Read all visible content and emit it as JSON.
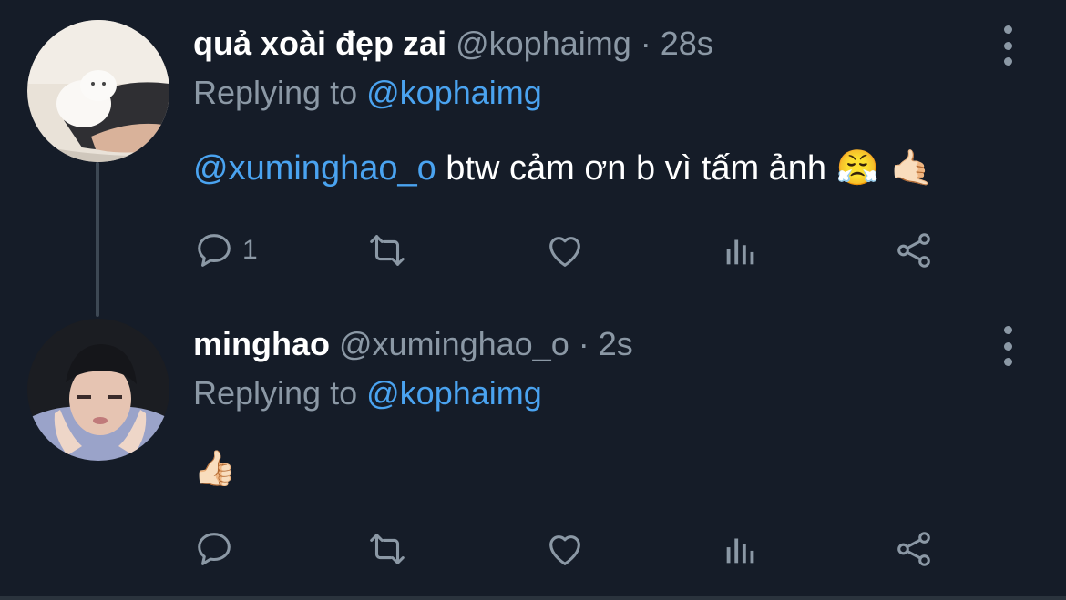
{
  "colors": {
    "background": "#151c28",
    "text_primary": "#ffffff",
    "text_secondary": "#8b98a5",
    "link": "#4aa3f0",
    "thread_line": "#3d4854"
  },
  "tweets": [
    {
      "display_name": "quả xoài đẹp zai",
      "handle": "@kophaimg",
      "separator": "·",
      "time": "28s",
      "replying_prefix": "Replying to",
      "replying_to": "@kophaimg",
      "mention": "@xuminghao_o",
      "text": " btw cảm ơn b vì tấm ảnh ",
      "emojis": "😤 🤙🏻",
      "reply_count": "1",
      "avatar_icon": "avatar-cat-icon"
    },
    {
      "display_name": "minghao",
      "handle": "@xuminghao_o",
      "separator": "·",
      "time": "2s",
      "replying_prefix": "Replying to",
      "replying_to": "@kophaimg",
      "mention": "",
      "text": "",
      "emojis": "👍🏻",
      "reply_count": "",
      "avatar_icon": "avatar-person-icon"
    }
  ],
  "action_icons": [
    "reply-icon",
    "retweet-icon",
    "like-icon",
    "analytics-icon",
    "share-icon"
  ]
}
